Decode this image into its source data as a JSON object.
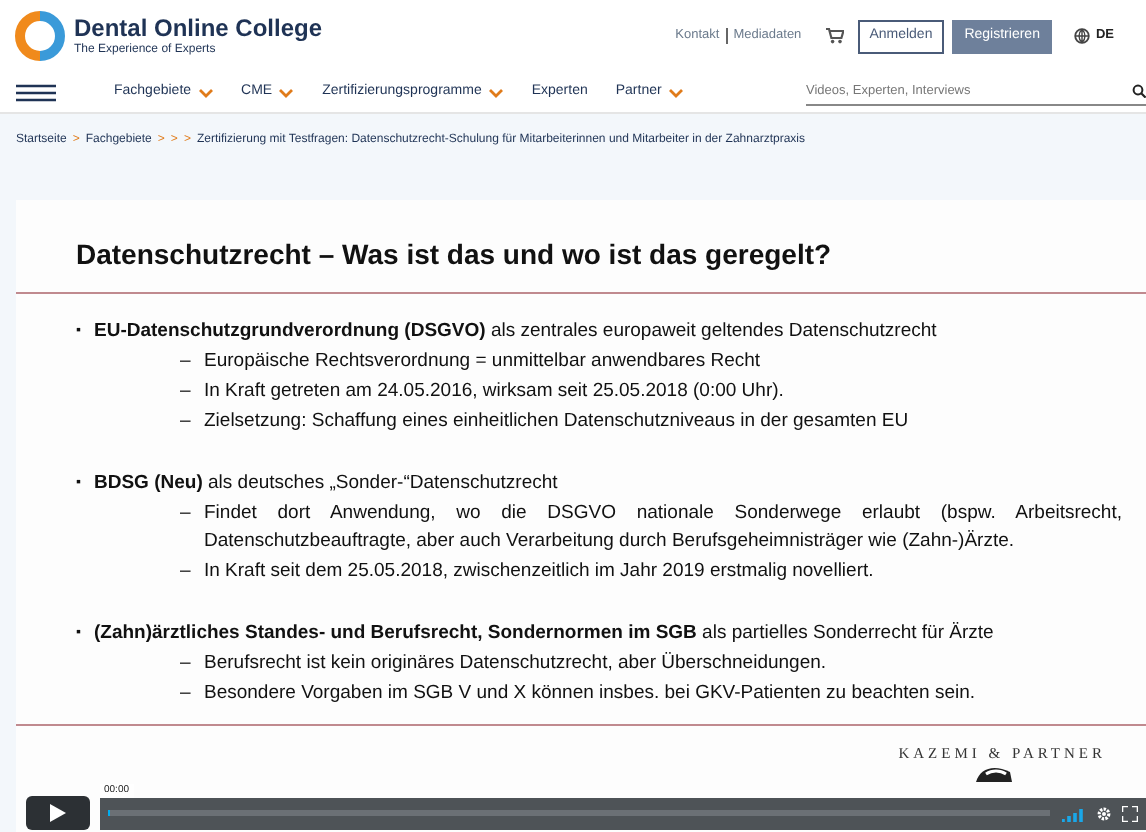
{
  "brand": {
    "name": "Dental Online College",
    "tagline": "The Experience of Experts"
  },
  "top_links": [
    "Kontakt",
    "Mediadaten"
  ],
  "buttons": [
    {
      "label": "Anmelden",
      "kind": "outline"
    },
    {
      "label": "Registrieren",
      "kind": "filled"
    }
  ],
  "language": "DE",
  "nav": [
    {
      "label": "Fachgebiete",
      "dropdown": true
    },
    {
      "label": "CME",
      "dropdown": true
    },
    {
      "label": "Zertifizierungsprogramme",
      "dropdown": true
    },
    {
      "label": "Experten",
      "dropdown": false
    },
    {
      "label": "Partner",
      "dropdown": true
    }
  ],
  "search": {
    "placeholder": "Videos, Experten, Interviews"
  },
  "breadcrumb": [
    {
      "kind": "link",
      "text": "Startseite"
    },
    {
      "kind": "separator",
      "text": ">"
    },
    {
      "kind": "link",
      "text": "Fachgebiete"
    },
    {
      "kind": "separator",
      "text": ">"
    },
    {
      "kind": "separator",
      "text": ">"
    },
    {
      "kind": "separator",
      "text": ">"
    },
    {
      "kind": "current",
      "text": "Zertifizierung mit Testfragen: Datenschutzrecht-Schulung für Mitarbeiterinnen und Mitarbeiter in der Zahnarztpraxis"
    }
  ],
  "slide": {
    "title": "Datenschutzrecht – Was ist das und wo ist das geregelt?",
    "bullets": [
      {
        "marker": "▪",
        "text": "**EU-Datenschutzgrundverordnung (DSGVO)** als zentrales europaweit geltendes Datenschutzrecht",
        "children": [
          {
            "marker": "–",
            "text": "Europäische Rechtsverordnung = unmittelbar anwendbares Recht"
          },
          {
            "marker": "–",
            "text": "In Kraft getreten am 24.05.2016, wirksam seit 25.05.2018 (0:00 Uhr)."
          },
          {
            "marker": "–",
            "text": "Zielsetzung: Schaffung eines einheitlichen Datenschutzniveaus in der gesamten EU"
          }
        ]
      },
      {
        "marker": "▪",
        "text": "**BDSG (Neu)** als deutsches „Sonder-“Datenschutzrecht",
        "children": [
          {
            "marker": "–",
            "text": "Findet dort Anwendung, wo die DSGVO nationale Sonderwege erlaubt (bspw. Arbeitsrecht, Datenschutzbeauftragte, aber auch Verarbeitung durch Berufsgeheimnisträger wie (Zahn-)Ärzte."
          },
          {
            "marker": "–",
            "text": "In Kraft seit dem 25.05.2018, zwischenzeitlich im Jahr 2019 erstmalig novelliert."
          }
        ]
      },
      {
        "marker": "▪",
        "text": "**(Zahn)ärztliches Standes- und Berufsrecht, Sondernormen im SGB** als partielles Sonderrecht für Ärzte",
        "children": [
          {
            "marker": "–",
            "text": "Berufsrecht ist kein originäres Datenschutzrecht, aber Überschneidungen."
          },
          {
            "marker": "–",
            "text": "Besondere Vorgaben im SGB V und X können insbes. bei GKV-Patienten zu beachten sein."
          }
        ]
      }
    ],
    "logo_text": "KAZEMI & PARTNER"
  },
  "player": {
    "time": "00:00",
    "level": 0.0
  }
}
